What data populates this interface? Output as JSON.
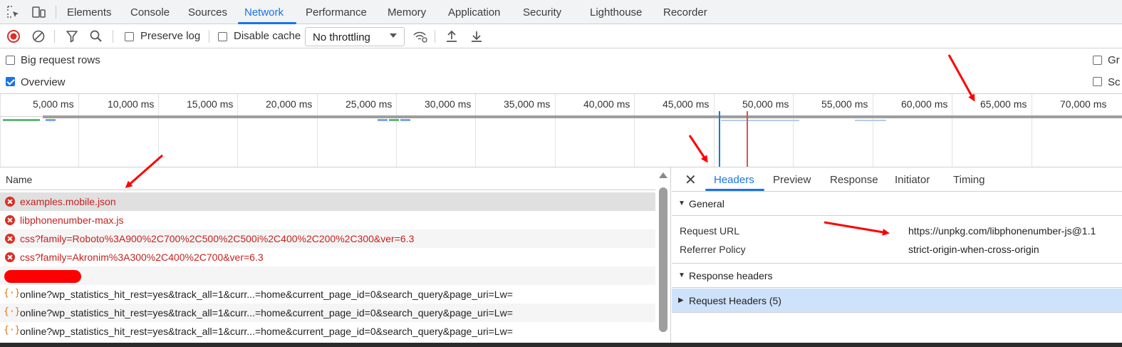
{
  "tabs": [
    "Elements",
    "Console",
    "Sources",
    "Network",
    "Performance",
    "Memory",
    "Application",
    "Security",
    "Lighthouse",
    "Recorder"
  ],
  "active_tab": "Network",
  "toolbar": {
    "preserve_log": "Preserve log",
    "disable_cache": "Disable cache",
    "throttling": "No throttling",
    "preserve_log_checked": false,
    "disable_cache_checked": false
  },
  "settings": {
    "big_request_rows": "Big request rows",
    "overview": "Overview",
    "big_request_rows_checked": false,
    "overview_checked": true,
    "right_cb_1": "Gr",
    "right_cb_2": "Sc"
  },
  "timeline_ticks": [
    "5,000 ms",
    "10,000 ms",
    "15,000 ms",
    "20,000 ms",
    "25,000 ms",
    "30,000 ms",
    "35,000 ms",
    "40,000 ms",
    "45,000 ms",
    "50,000 ms",
    "55,000 ms",
    "60,000 ms",
    "65,000 ms",
    "70,000 ms"
  ],
  "requests": {
    "header": "Name",
    "rows": [
      {
        "name": "examples.mobile.json",
        "status": "error"
      },
      {
        "name": "libphonenumber-max.js",
        "status": "error"
      },
      {
        "name": "css?family=Roboto%3A900%2C700%2C500%2C500i%2C400%2C200%2C300&ver=6.3",
        "status": "error"
      },
      {
        "name": "css?family=Akronim%3A300%2C400%2C700&ver=6.3",
        "status": "error"
      },
      {
        "name": "",
        "status": "redacted"
      },
      {
        "name": "online?wp_statistics_hit_rest=yes&track_all=1&curr...=home&current_page_id=0&search_query&page_uri=Lw=",
        "status": "fetch"
      },
      {
        "name": "online?wp_statistics_hit_rest=yes&track_all=1&curr...=home&current_page_id=0&search_query&page_uri=Lw=",
        "status": "fetch"
      },
      {
        "name": "online?wp_statistics_hit_rest=yes&track_all=1&curr...=home&current_page_id=0&search_query&page_uri=Lw=",
        "status": "fetch"
      }
    ]
  },
  "details": {
    "tabs": [
      "Headers",
      "Preview",
      "Response",
      "Initiator",
      "Timing"
    ],
    "active_tab": "Headers",
    "general_title": "General",
    "request_url_label": "Request URL",
    "request_url_value": "https://unpkg.com/libphonenumber-js@1.1",
    "referrer_policy_label": "Referrer Policy",
    "referrer_policy_value": "strict-origin-when-cross-origin",
    "response_headers_title": "Response headers",
    "request_headers_title": "Request Headers (5)"
  },
  "colors": {
    "accent": "#1a73e8",
    "error": "#d93025",
    "annotation": "#ff0000"
  }
}
